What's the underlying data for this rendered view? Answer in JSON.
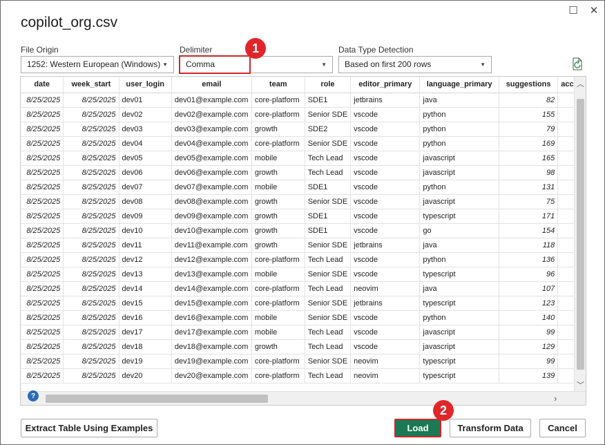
{
  "window": {
    "title": "copilot_org.csv"
  },
  "controls": {
    "file_origin": {
      "label": "File Origin",
      "value": "1252: Western European (Windows)"
    },
    "delimiter": {
      "label": "Delimiter",
      "value": "Comma"
    },
    "data_type": {
      "label": "Data Type Detection",
      "value": "Based on first 200 rows"
    }
  },
  "annotations": {
    "step1": "1",
    "step2": "2"
  },
  "table": {
    "columns": [
      "date",
      "week_start",
      "user_login",
      "email",
      "team",
      "role",
      "editor_primary",
      "language_primary",
      "suggestions",
      "acce"
    ],
    "rows": [
      [
        "8/25/2025",
        "8/25/2025",
        "dev01",
        "dev01@example.com",
        "core-platform",
        "SDE1",
        "jetbrains",
        "java",
        "82"
      ],
      [
        "8/25/2025",
        "8/25/2025",
        "dev02",
        "dev02@example.com",
        "core-platform",
        "Senior SDE",
        "vscode",
        "python",
        "155"
      ],
      [
        "8/25/2025",
        "8/25/2025",
        "dev03",
        "dev03@example.com",
        "growth",
        "SDE2",
        "vscode",
        "python",
        "79"
      ],
      [
        "8/25/2025",
        "8/25/2025",
        "dev04",
        "dev04@example.com",
        "core-platform",
        "Senior SDE",
        "vscode",
        "python",
        "169"
      ],
      [
        "8/25/2025",
        "8/25/2025",
        "dev05",
        "dev05@example.com",
        "mobile",
        "Tech Lead",
        "vscode",
        "javascript",
        "165"
      ],
      [
        "8/25/2025",
        "8/25/2025",
        "dev06",
        "dev06@example.com",
        "growth",
        "Tech Lead",
        "vscode",
        "javascript",
        "98"
      ],
      [
        "8/25/2025",
        "8/25/2025",
        "dev07",
        "dev07@example.com",
        "mobile",
        "SDE1",
        "vscode",
        "python",
        "131"
      ],
      [
        "8/25/2025",
        "8/25/2025",
        "dev08",
        "dev08@example.com",
        "growth",
        "Senior SDE",
        "vscode",
        "javascript",
        "75"
      ],
      [
        "8/25/2025",
        "8/25/2025",
        "dev09",
        "dev09@example.com",
        "growth",
        "SDE1",
        "vscode",
        "typescript",
        "171"
      ],
      [
        "8/25/2025",
        "8/25/2025",
        "dev10",
        "dev10@example.com",
        "growth",
        "SDE1",
        "vscode",
        "go",
        "154"
      ],
      [
        "8/25/2025",
        "8/25/2025",
        "dev11",
        "dev11@example.com",
        "growth",
        "Senior SDE",
        "jetbrains",
        "java",
        "118"
      ],
      [
        "8/25/2025",
        "8/25/2025",
        "dev12",
        "dev12@example.com",
        "core-platform",
        "Tech Lead",
        "vscode",
        "python",
        "136"
      ],
      [
        "8/25/2025",
        "8/25/2025",
        "dev13",
        "dev13@example.com",
        "mobile",
        "Senior SDE",
        "vscode",
        "typescript",
        "96"
      ],
      [
        "8/25/2025",
        "8/25/2025",
        "dev14",
        "dev14@example.com",
        "core-platform",
        "Tech Lead",
        "neovim",
        "java",
        "107"
      ],
      [
        "8/25/2025",
        "8/25/2025",
        "dev15",
        "dev15@example.com",
        "core-platform",
        "Senior SDE",
        "jetbrains",
        "typescript",
        "123"
      ],
      [
        "8/25/2025",
        "8/25/2025",
        "dev16",
        "dev16@example.com",
        "mobile",
        "Senior SDE",
        "vscode",
        "python",
        "140"
      ],
      [
        "8/25/2025",
        "8/25/2025",
        "dev17",
        "dev17@example.com",
        "mobile",
        "Tech Lead",
        "vscode",
        "javascript",
        "99"
      ],
      [
        "8/25/2025",
        "8/25/2025",
        "dev18",
        "dev18@example.com",
        "growth",
        "Tech Lead",
        "vscode",
        "javascript",
        "129"
      ],
      [
        "8/25/2025",
        "8/25/2025",
        "dev19",
        "dev19@example.com",
        "core-platform",
        "Senior SDE",
        "neovim",
        "typescript",
        "99"
      ],
      [
        "8/25/2025",
        "8/25/2025",
        "dev20",
        "dev20@example.com",
        "core-platform",
        "Tech Lead",
        "neovim",
        "typescript",
        "139"
      ]
    ]
  },
  "buttons": {
    "extract": "Extract Table Using Examples",
    "load": "Load",
    "transform": "Transform Data",
    "cancel": "Cancel"
  }
}
